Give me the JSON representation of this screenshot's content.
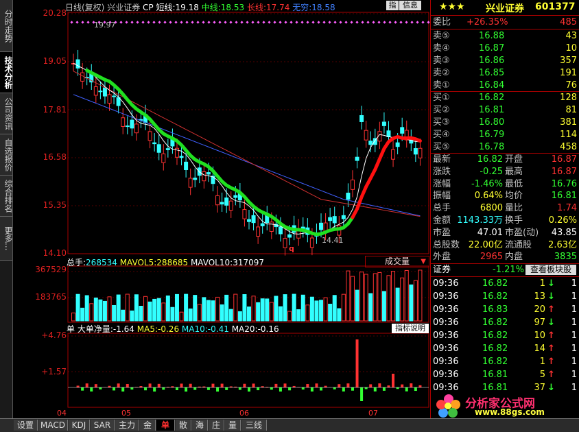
{
  "left_tabs": [
    {
      "label": "分时走势",
      "active": false
    },
    {
      "label": "技术分析",
      "active": true
    },
    {
      "label": "公司资讯",
      "active": false
    },
    {
      "label": "自选报价",
      "active": false
    },
    {
      "label": "综合排名",
      "active": false
    },
    {
      "label": "更多...",
      "active": false
    }
  ],
  "bottom_tabs": [
    {
      "label": "设置",
      "active": false
    },
    {
      "label": "MACD",
      "active": false
    },
    {
      "label": "KDJ",
      "active": false
    },
    {
      "label": "SAR",
      "active": false
    },
    {
      "label": "主力",
      "active": false
    },
    {
      "label": "金",
      "active": false
    },
    {
      "label": "单",
      "active": true
    },
    {
      "label": "散",
      "active": false
    },
    {
      "label": "海",
      "active": false
    },
    {
      "label": "庄",
      "active": false
    },
    {
      "label": "量",
      "active": false
    },
    {
      "label": "三线",
      "active": false
    }
  ],
  "main_header": {
    "period": "日线(复权)",
    "name": "兴业证券",
    "formula": "CP",
    "short_label": "短线:",
    "short_value": "19.18",
    "mid_label": "中线:",
    "mid_value": "18.53",
    "long_label": "长线:",
    "long_value": "17.74",
    "weak_label": "无穷:",
    "weak_value": "18.58"
  },
  "top_buttons": {
    "indicator": "指",
    "info": "信息"
  },
  "price_axis": [
    "20.28",
    "19.05",
    "17.81",
    "16.58",
    "15.35",
    "14.10"
  ],
  "annotations": {
    "high": "19.97",
    "low": "14.41",
    "marker": "q"
  },
  "volume_header": {
    "total_label": "总手:",
    "total_value": "268534",
    "mavol5_label": "MAVOL5:",
    "mavol5_value": "288685",
    "mavol10_label": "MAVOL10:",
    "mavol10_value": "317097",
    "button": "成交量"
  },
  "volume_axis": [
    "367529",
    "183765"
  ],
  "flow_header": {
    "prefix": "单",
    "name_label": "大单净量:",
    "name_value": "-1.64",
    "ma5_label": "MA5:",
    "ma5_value": "-0.26",
    "ma10_label": "MA10:",
    "ma10_value": "-0.41",
    "ma20_label": "MA20:",
    "ma20_value": "-0.16",
    "button": "指标说明"
  },
  "flow_axis": [
    "+4.76",
    "+1.57"
  ],
  "month_axis": [
    "04",
    "05",
    "06",
    "07"
  ],
  "stock": {
    "stars": "★★★",
    "name": "兴业证券",
    "code": "601377"
  },
  "order_ratio": {
    "label": "委比",
    "pct": "+26.35%",
    "diff": "485"
  },
  "sells": [
    {
      "label": "卖⑤",
      "price": "16.88",
      "vol": "43"
    },
    {
      "label": "卖④",
      "price": "16.87",
      "vol": "10"
    },
    {
      "label": "卖③",
      "price": "16.86",
      "vol": "357"
    },
    {
      "label": "卖②",
      "price": "16.85",
      "vol": "191"
    },
    {
      "label": "卖①",
      "price": "16.84",
      "vol": "76"
    }
  ],
  "buys": [
    {
      "label": "买①",
      "price": "16.82",
      "vol": "128"
    },
    {
      "label": "买②",
      "price": "16.81",
      "vol": "81"
    },
    {
      "label": "买③",
      "price": "16.80",
      "vol": "381"
    },
    {
      "label": "买④",
      "price": "16.79",
      "vol": "114"
    },
    {
      "label": "买⑤",
      "price": "16.78",
      "vol": "458"
    }
  ],
  "quote": [
    {
      "l1": "最新",
      "v1": "16.82",
      "c1": "green",
      "l2": "开盘",
      "v2": "16.87",
      "c2": "red"
    },
    {
      "l1": "涨跌",
      "v1": "-0.25",
      "c1": "green",
      "l2": "最高",
      "v2": "16.87",
      "c2": "red"
    },
    {
      "l1": "涨幅",
      "v1": "-1.46%",
      "c1": "green",
      "l2": "最低",
      "v2": "16.76",
      "c2": "green"
    },
    {
      "l1": "振幅",
      "v1": "0.64%",
      "c1": "yellow",
      "l2": "均价",
      "v2": "16.81",
      "c2": "green"
    },
    {
      "l1": "总手",
      "v1": "6800",
      "c1": "yellow",
      "l2": "量比",
      "v2": "1.74",
      "c2": "red"
    },
    {
      "l1": "金额",
      "v1": "1143.33万",
      "c1": "cyan",
      "l2": "换手",
      "v2": "0.26%",
      "c2": "yellow"
    },
    {
      "l1": "市盈",
      "v1": "47.01",
      "c1": "white",
      "l2": "市盈(动)",
      "v2": "43.85",
      "c2": "white"
    },
    {
      "l1": "总股数",
      "v1": "22.00亿",
      "c1": "yellow",
      "l2": "流通股",
      "v2": "2.63亿",
      "c2": "yellow"
    },
    {
      "l1": "外盘",
      "v1": "2965",
      "c1": "red",
      "l2": "内盘",
      "v2": "3835",
      "c2": "green"
    }
  ],
  "sector": {
    "label": "证券",
    "pct": "-1.21%",
    "button": "查看板块股"
  },
  "ticks": [
    {
      "time": "09:36",
      "price": "16.82",
      "vol": "1",
      "dir": "down",
      "n": "1"
    },
    {
      "time": "09:36",
      "price": "16.82",
      "vol": "13",
      "dir": "down",
      "n": "1"
    },
    {
      "time": "09:36",
      "price": "16.83",
      "vol": "20",
      "dir": "up",
      "n": "1"
    },
    {
      "time": "09:36",
      "price": "16.82",
      "vol": "97",
      "dir": "down",
      "n": "1"
    },
    {
      "time": "09:36",
      "price": "16.82",
      "vol": "10",
      "dir": "up",
      "n": "1"
    },
    {
      "time": "09:36",
      "price": "16.82",
      "vol": "14",
      "dir": "up",
      "n": "1"
    },
    {
      "time": "09:36",
      "price": "16.82",
      "vol": "1",
      "dir": "up",
      "n": "1"
    },
    {
      "time": "09:36",
      "price": "16.81",
      "vol": "5",
      "dir": "up",
      "n": "1"
    },
    {
      "time": "09:36",
      "price": "16.81",
      "vol": "37",
      "dir": "down",
      "n": "1"
    }
  ],
  "watermark": {
    "name": "分析家公式网",
    "url": "www.88gs.com"
  },
  "colors": {
    "up": "#ff3232",
    "down": "#32ffff",
    "green": "#32ff32",
    "yellow": "#ffff32",
    "border": "#aa0000",
    "grid": "#aa0000"
  }
}
